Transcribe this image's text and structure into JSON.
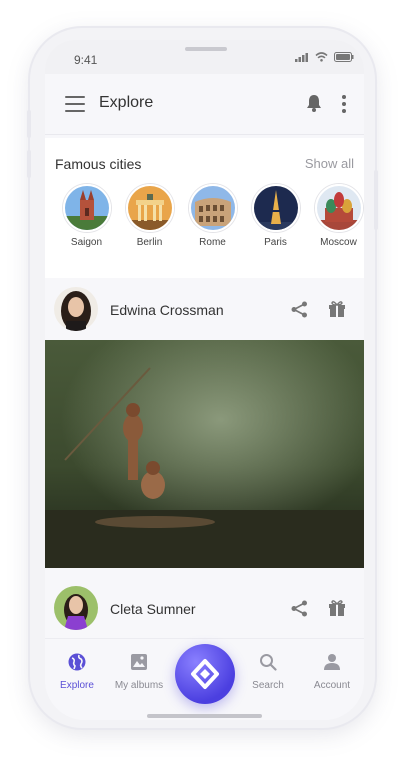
{
  "status_bar": {
    "time": "9:41"
  },
  "header": {
    "title": "Explore",
    "menu_icon": "hamburger-icon",
    "bell_icon": "bell-icon",
    "more_icon": "kebab-icon"
  },
  "cities": {
    "title": "Famous cities",
    "show_all": "Show all",
    "items": [
      {
        "name": "Saigon"
      },
      {
        "name": "Berlin"
      },
      {
        "name": "Rome"
      },
      {
        "name": "Paris"
      },
      {
        "name": "Moscow"
      }
    ]
  },
  "posts": [
    {
      "author": "Edwina Crossman"
    },
    {
      "author": "Cleta Sumner"
    }
  ],
  "tabbar": {
    "tabs": [
      {
        "label": "Explore",
        "icon": "globe-icon",
        "active": true
      },
      {
        "label": "My albums",
        "icon": "image-icon",
        "active": false
      },
      {
        "label": "Search",
        "icon": "search-icon",
        "active": false
      },
      {
        "label": "Account",
        "icon": "user-icon",
        "active": false
      }
    ],
    "fab_icon": "diamond-logo-icon"
  },
  "colors": {
    "accent": "#5b50d6",
    "fab": "#5a4fe6"
  }
}
